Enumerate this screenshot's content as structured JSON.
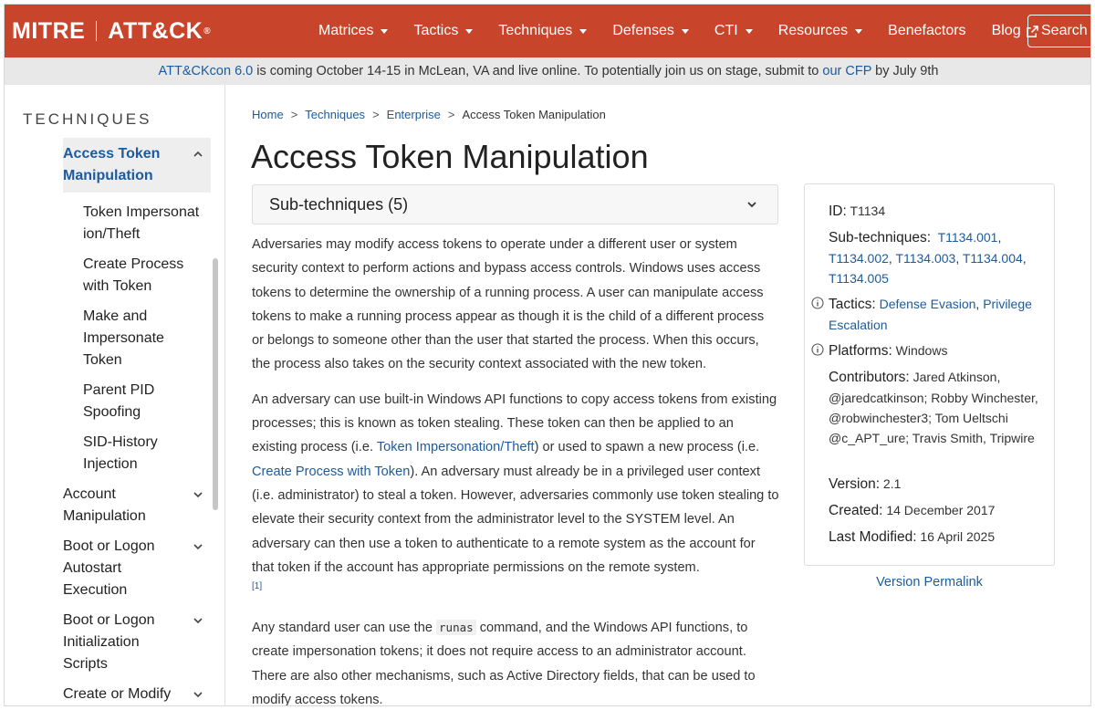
{
  "navbar": {
    "logo_left": "MITRE",
    "logo_right": "ATT&CK",
    "logo_reg": "®",
    "items": [
      {
        "label": "Matrices"
      },
      {
        "label": "Tactics"
      },
      {
        "label": "Techniques"
      },
      {
        "label": "Defenses"
      },
      {
        "label": "CTI"
      },
      {
        "label": "Resources"
      },
      {
        "label": "Benefactors"
      },
      {
        "label": "Blog"
      }
    ],
    "search_label": "Search"
  },
  "banner": {
    "link1": "ATT&CKcon 6.0",
    "text1": " is coming October 14-15 in McLean, VA and live online. To potentially join us on stage, submit to ",
    "link2": "our CFP",
    "text2": " by July 9th"
  },
  "sidebar": {
    "heading": "TECHNIQUES",
    "active": "Access Token Manipulation",
    "subs": [
      "Token Impersonation/Theft",
      "Create Process with Token",
      "Make and Impersonate Token",
      "Parent PID Spoofing",
      "SID-History Injection"
    ],
    "items": [
      "Account Manipulation",
      "Boot or Logon Autostart Execution",
      "Boot or Logon Initialization Scripts",
      "Create or Modify System Process"
    ]
  },
  "breadcrumb": {
    "home": "Home",
    "techniques": "Techniques",
    "enterprise": "Enterprise",
    "current": "Access Token Manipulation"
  },
  "main": {
    "title": "Access Token Manipulation",
    "subtechniques_label": "Sub-techniques (5)",
    "p1": "Adversaries may modify access tokens to operate under a different user or system security context to perform actions and bypass access controls. Windows uses access tokens to determine the ownership of a running process. A user can manipulate access tokens to make a running process appear as though it is the child of a different process or belongs to someone other than the user that started the process. When this occurs, the process also takes on the security context associated with the new token.",
    "p2_a": "An adversary can use built-in Windows API functions to copy access tokens from existing processes; this is known as token stealing. These token can then be applied to an existing process (i.e. ",
    "p2_link1": "Token Impersonation/Theft",
    "p2_b": ") or used to spawn a new process (i.e. ",
    "p2_link2": "Create Process with Token",
    "p2_c": "). An adversary must already be in a privileged user context (i.e. administrator) to steal a token. However, adversaries commonly use token stealing to elevate their security context from the administrator level to the SYSTEM level. An adversary can then use a token to authenticate to a remote system as the account for that token if the account has appropriate permissions on the remote system.",
    "p2_ref": "[1]",
    "p3_a": "Any standard user can use the ",
    "p3_code": "runas",
    "p3_b": " command, and the Windows API functions, to create impersonation tokens; it does not require access to an administrator account. There are also other mechanisms, such as Active Directory fields, that can be used to modify access tokens."
  },
  "card": {
    "id_label": "ID:",
    "id_value": "T1134",
    "sub_label": "Sub-techniques:",
    "sub_values": [
      "T1134.001",
      "T1134.002",
      "T1134.003",
      "T1134.004",
      "T1134.005"
    ],
    "tactics_label": "Tactics:",
    "tactics": [
      "Defense Evasion",
      "Privilege Escalation"
    ],
    "platforms_label": "Platforms:",
    "platforms_value": "Windows",
    "contributors_label": "Contributors:",
    "contributors_value": "Jared Atkinson, @jaredcatkinson; Robby Winchester, @robwinchester3; Tom Ueltschi @c_APT_ure; Travis Smith, Tripwire",
    "version_label": "Version:",
    "version_value": "2.1",
    "created_label": "Created:",
    "created_value": "14 December 2017",
    "modified_label": "Last Modified:",
    "modified_value": "16 April 2025",
    "permalink": "Version Permalink"
  },
  "colors": {
    "navbar": "#c8442a",
    "link": "#1c5b9e",
    "banner_bg": "#e8e8e8"
  }
}
